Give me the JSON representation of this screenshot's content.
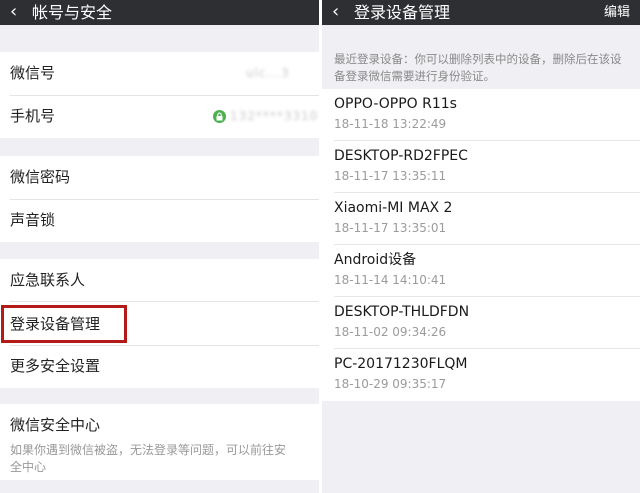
{
  "left": {
    "title": "帐号与安全",
    "back_icon": "chevron-left-icon",
    "wechat_id_label": "微信号",
    "wechat_id_value": "ulc...3",
    "phone_label": "手机号",
    "phone_value": "132****3310",
    "wechat_password_label": "微信密码",
    "voice_lock_label": "声音锁",
    "emergency_contacts_label": "应急联系人",
    "login_device_label": "登录设备管理",
    "more_security_label": "更多安全设置",
    "security_center_label": "微信安全中心",
    "security_center_desc": "如果你遇到微信被盗，无法登录等问题，可以前往安全中心",
    "highlight_color": "#b31b1b"
  },
  "right": {
    "title": "登录设备管理",
    "edit_label": "编辑",
    "hint": "最近登录设备：你可以删除列表中的设备，删除后在该设备登录微信需要进行身份验证。",
    "devices": [
      {
        "name": "OPPO-OPPO R11s",
        "time": "18-11-18 13:22:49"
      },
      {
        "name": "DESKTOP-RD2FPEC",
        "time": "18-11-17 13:35:11"
      },
      {
        "name": "Xiaomi-MI MAX 2",
        "time": "18-11-17 13:35:01"
      },
      {
        "name": "Android设备",
        "time": "18-11-14 14:10:41"
      },
      {
        "name": "DESKTOP-THLDFDN",
        "time": "18-11-02 09:34:26"
      },
      {
        "name": "PC-20171230FLQM",
        "time": "18-10-29 09:35:17"
      }
    ]
  },
  "colors": {
    "topbar": "#2e2f33",
    "background": "#efeff4",
    "lock_green": "#4cb050"
  }
}
